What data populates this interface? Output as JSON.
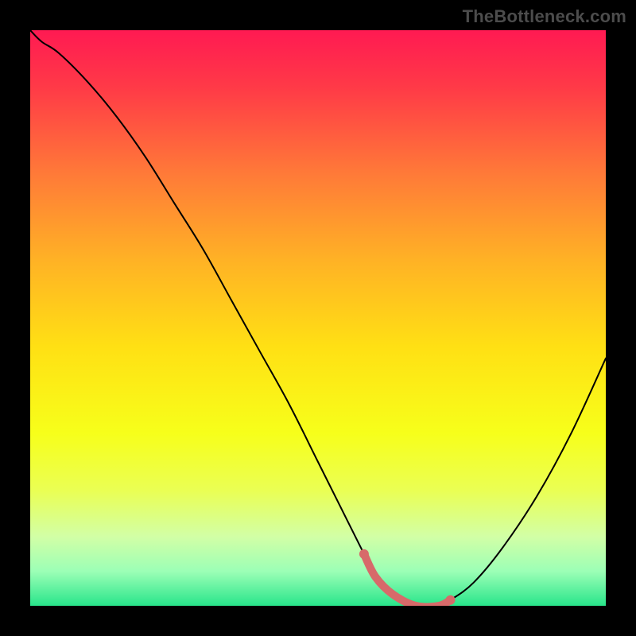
{
  "watermark": "TheBottleneck.com",
  "chart_data": {
    "type": "line",
    "title": "",
    "xlabel": "",
    "ylabel": "",
    "xlim": [
      0,
      100
    ],
    "ylim": [
      0,
      100
    ],
    "grid": false,
    "legend": false,
    "background_gradient": {
      "stops": [
        {
          "offset": 0.0,
          "color": "#ff1a52"
        },
        {
          "offset": 0.1,
          "color": "#ff3a47"
        },
        {
          "offset": 0.25,
          "color": "#ff7a38"
        },
        {
          "offset": 0.4,
          "color": "#ffb225"
        },
        {
          "offset": 0.55,
          "color": "#ffe014"
        },
        {
          "offset": 0.7,
          "color": "#f7ff1a"
        },
        {
          "offset": 0.8,
          "color": "#eaff54"
        },
        {
          "offset": 0.88,
          "color": "#d2ffa6"
        },
        {
          "offset": 0.94,
          "color": "#9cffb6"
        },
        {
          "offset": 1.0,
          "color": "#28e58b"
        }
      ]
    },
    "series": [
      {
        "name": "bottleneck-curve",
        "stroke": "#000000",
        "stroke_width": 2,
        "x": [
          0,
          2,
          5,
          10,
          15,
          20,
          25,
          30,
          35,
          40,
          45,
          50,
          55,
          58,
          60,
          63,
          67,
          71,
          73,
          77,
          82,
          88,
          94,
          100
        ],
        "y": [
          100,
          98,
          96,
          91,
          85,
          78,
          70,
          62,
          53,
          44,
          35,
          25,
          15,
          9,
          5,
          2,
          0,
          0,
          1,
          4,
          10,
          19,
          30,
          43
        ]
      },
      {
        "name": "sweet-spot-marker",
        "stroke": "#d76a6a",
        "stroke_width": 10,
        "x": [
          58,
          60,
          63,
          67,
          71,
          73
        ],
        "y": [
          9,
          5,
          2,
          0,
          0,
          1
        ]
      }
    ],
    "marker_dots": {
      "color": "#d76a6a",
      "radius": 6,
      "points": [
        {
          "x": 58,
          "y": 9
        },
        {
          "x": 73,
          "y": 1
        }
      ]
    }
  }
}
